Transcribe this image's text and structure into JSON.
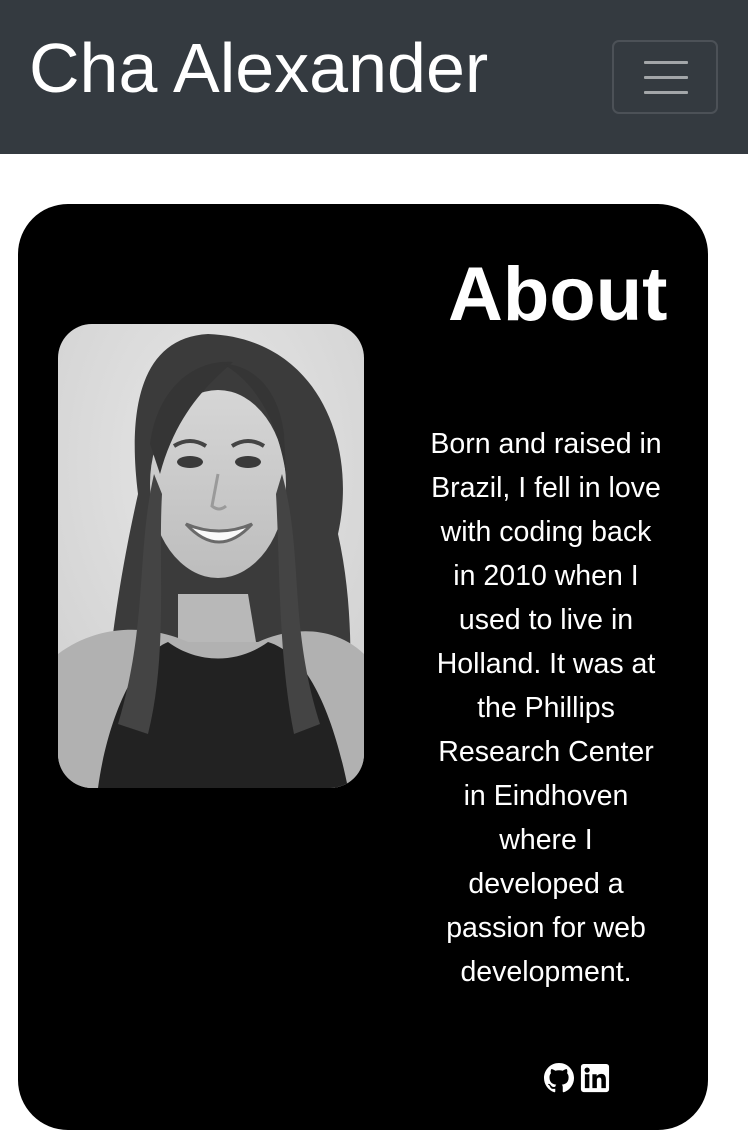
{
  "navbar": {
    "brand": "Cha Alexander",
    "toggler_icon": "hamburger-menu-icon",
    "background": "#343a40"
  },
  "about": {
    "title": "About",
    "bio": "Born and raised in Brazil, I fell in love with coding back in 2010 when I used to live in Holland. It was at the Phillips Research Center in Eindhoven where I developed a passion for web development.",
    "photo_alt": "Cha Alexander",
    "social_icons": [
      "github-icon",
      "linkedin-icon"
    ],
    "card_background": "#000000"
  }
}
